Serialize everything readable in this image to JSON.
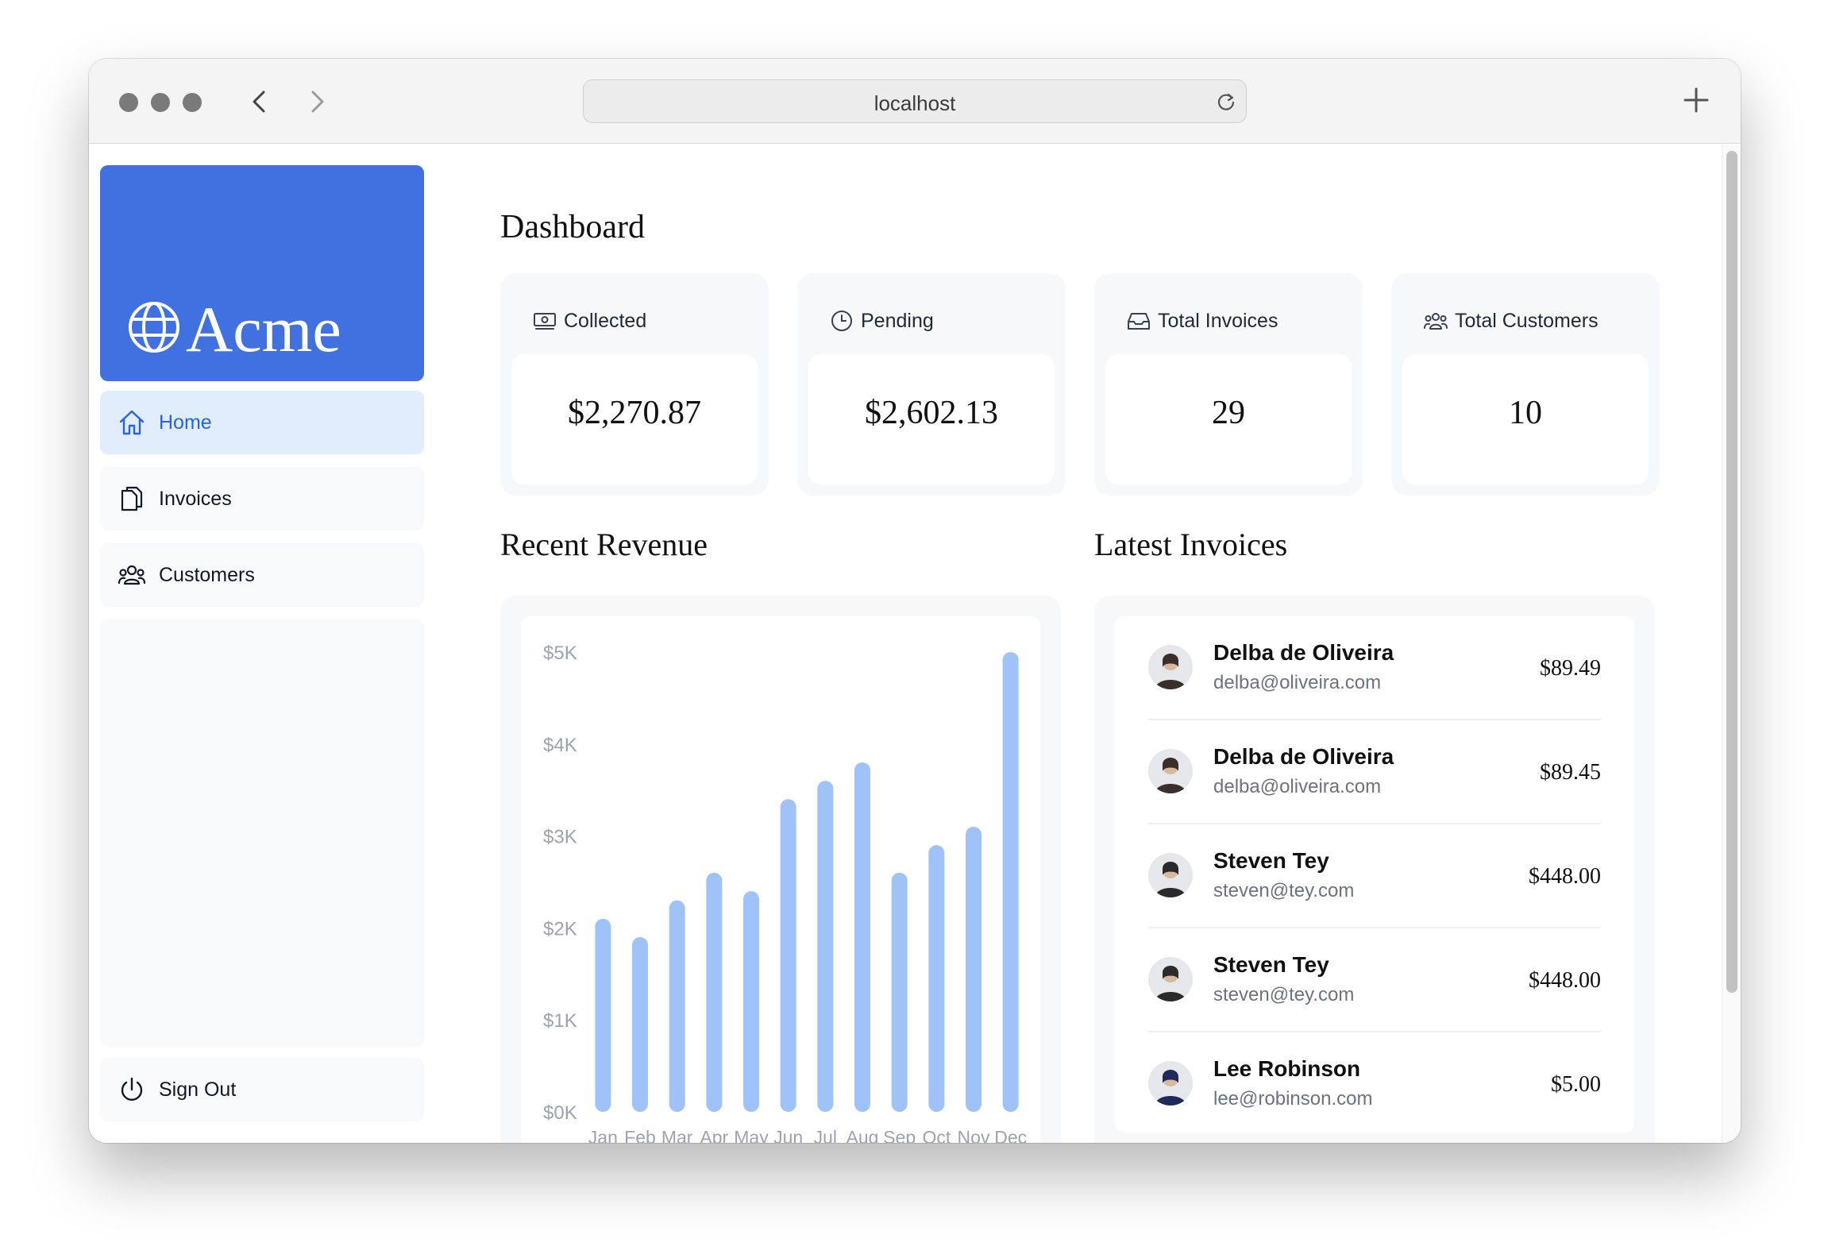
{
  "browser": {
    "url": "localhost"
  },
  "sidebar": {
    "logo_text": "Acme",
    "items": [
      {
        "label": "Home",
        "icon": "home-icon",
        "active": true
      },
      {
        "label": "Invoices",
        "icon": "document-icon",
        "active": false
      },
      {
        "label": "Customers",
        "icon": "users-icon",
        "active": false
      }
    ],
    "sign_out_label": "Sign Out"
  },
  "main": {
    "title": "Dashboard",
    "cards": [
      {
        "title": "Collected",
        "value": "$2,270.87",
        "icon": "banknotes-icon"
      },
      {
        "title": "Pending",
        "value": "$2,602.13",
        "icon": "clock-icon"
      },
      {
        "title": "Total Invoices",
        "value": "29",
        "icon": "inbox-icon"
      },
      {
        "title": "Total Customers",
        "value": "10",
        "icon": "user-group-icon"
      }
    ],
    "revenue_title": "Recent Revenue",
    "invoices_title": "Latest Invoices",
    "latest_invoices": [
      {
        "name": "Delba de Oliveira",
        "email": "delba@oliveira.com",
        "amount": "$89.49"
      },
      {
        "name": "Delba de Oliveira",
        "email": "delba@oliveira.com",
        "amount": "$89.45"
      },
      {
        "name": "Steven Tey",
        "email": "steven@tey.com",
        "amount": "$448.00"
      },
      {
        "name": "Steven Tey",
        "email": "steven@tey.com",
        "amount": "$448.00"
      },
      {
        "name": "Lee Robinson",
        "email": "lee@robinson.com",
        "amount": "$5.00"
      }
    ]
  },
  "colors": {
    "brand": "#4170e1",
    "active_bg": "#e1edfd",
    "active_text": "#2563eb",
    "bar": "#9fc3f8"
  },
  "chart_data": {
    "type": "bar",
    "categories": [
      "Jan",
      "Feb",
      "Mar",
      "Apr",
      "May",
      "Jun",
      "Jul",
      "Aug",
      "Sep",
      "Oct",
      "Nov",
      "Dec"
    ],
    "values": [
      2100,
      1900,
      2300,
      2600,
      2400,
      3400,
      3600,
      3800,
      2600,
      2900,
      3100,
      5000
    ],
    "ytick_labels": [
      "$5K",
      "$4K",
      "$3K",
      "$2K",
      "$1K",
      "$0K"
    ],
    "ylim": [
      0,
      5000
    ],
    "title": "Recent Revenue",
    "xlabel": "",
    "ylabel": ""
  }
}
